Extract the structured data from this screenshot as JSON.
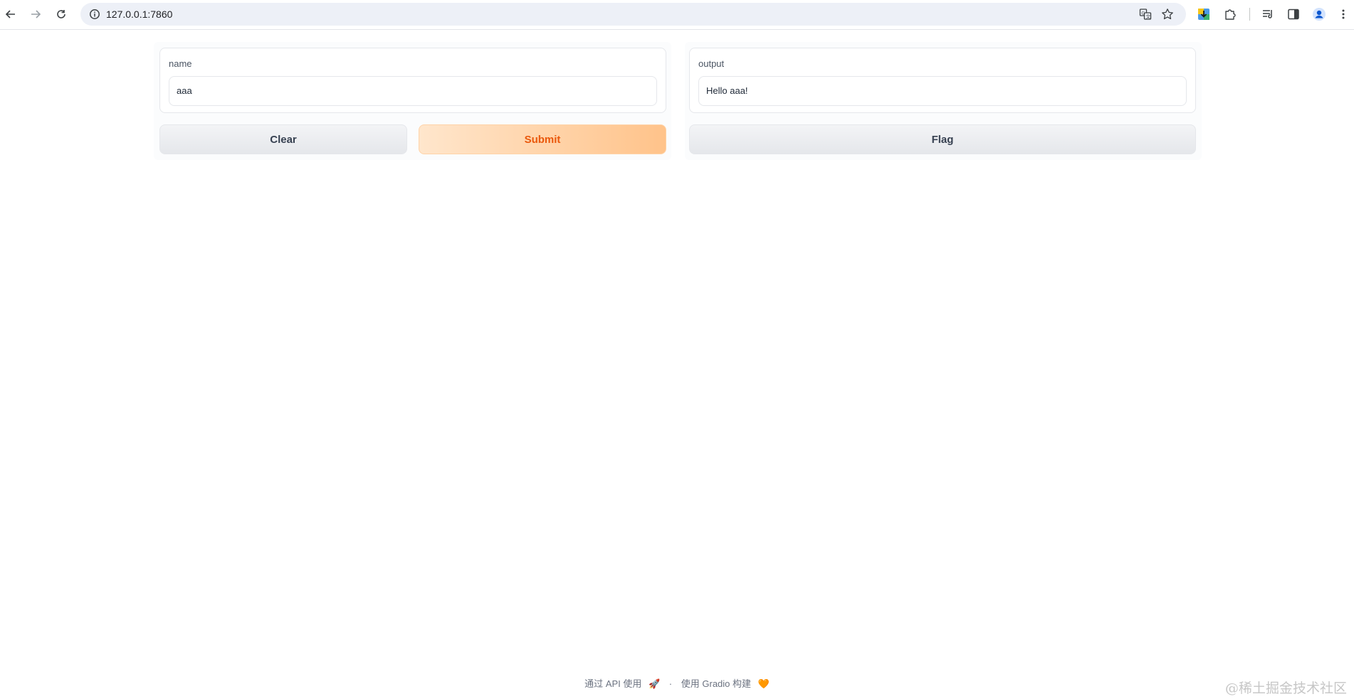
{
  "browser": {
    "url": "127.0.0.1:7860"
  },
  "app": {
    "input": {
      "label": "name",
      "value": "aaa"
    },
    "output": {
      "label": "output",
      "value": "Hello aaa!"
    },
    "buttons": {
      "clear": "Clear",
      "submit": "Submit",
      "flag": "Flag"
    }
  },
  "footer": {
    "api_text": "通过 API 使用",
    "api_emoji": "🚀",
    "separator": "·",
    "built_text": "使用 Gradio 构建",
    "built_emoji": "🧡"
  },
  "watermark": "@稀土掘金技术社区",
  "colors": {
    "primary_text": "#ea580c",
    "primary_bg_start": "#ffe6cc",
    "primary_bg_end": "#ffc38a"
  }
}
